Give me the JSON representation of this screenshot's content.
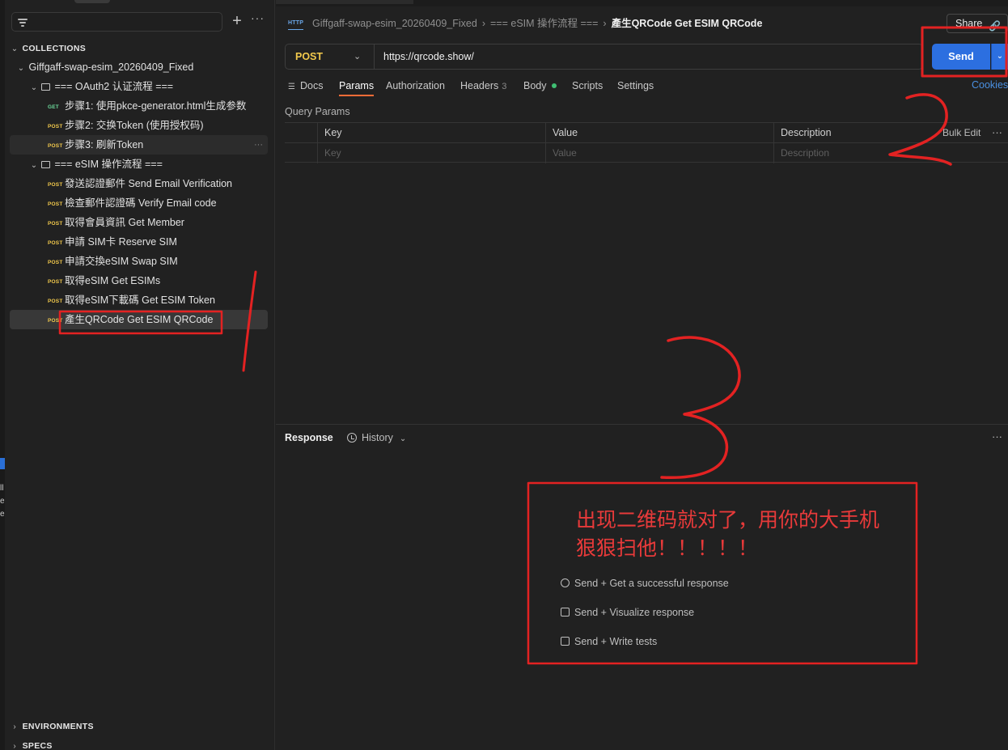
{
  "sidebar": {
    "filter_placeholder": "",
    "collections_label": "COLLECTIONS",
    "environments_label": "ENVIRONMENTS",
    "specs_label": "SPECS",
    "collection_name": "Giffgaff-swap-esim_20260409_Fixed",
    "folders": [
      {
        "name": "=== OAuth2 认证流程 ===",
        "requests": [
          {
            "method": "GET",
            "name": "步骤1: 使用pkce-generator.html生成参数"
          },
          {
            "method": "POST",
            "name": "步骤2: 交换Token (使用授权码)"
          },
          {
            "method": "POST",
            "name": "步骤3: 刷新Token"
          }
        ]
      },
      {
        "name": "=== eSIM 操作流程 ===",
        "requests": [
          {
            "method": "POST",
            "name": "發送認證郵件 Send Email Verification"
          },
          {
            "method": "POST",
            "name": "檢查郵件認證碼 Verify Email code"
          },
          {
            "method": "POST",
            "name": "取得會員資訊 Get Member"
          },
          {
            "method": "POST",
            "name": "申請 SIM卡 Reserve SIM"
          },
          {
            "method": "POST",
            "name": "申請交換eSIM Swap SIM"
          },
          {
            "method": "POST",
            "name": "取得eSIM Get ESIMs"
          },
          {
            "method": "POST",
            "name": "取得eSIM下載碼 Get ESIM Token"
          },
          {
            "method": "POST",
            "name": "產生QRCode Get ESIM QRCode"
          }
        ]
      }
    ]
  },
  "header": {
    "http_icon": "HTTP",
    "breadcrumb": [
      "Giffgaff-swap-esim_20260409_Fixed",
      "=== eSIM 操作流程 ===",
      "產生QRCode Get ESIM QRCode"
    ],
    "share_label": "Share"
  },
  "request": {
    "method": "POST",
    "url": "https://qrcode.show/",
    "send_label": "Send",
    "tabs": [
      {
        "label": "Docs"
      },
      {
        "label": "Params"
      },
      {
        "label": "Authorization"
      },
      {
        "label": "Headers",
        "count": "3"
      },
      {
        "label": "Body"
      },
      {
        "label": "Scripts"
      },
      {
        "label": "Settings"
      }
    ],
    "cookies_label": "Cookies"
  },
  "query_params": {
    "label": "Query Params",
    "columns": [
      "Key",
      "Value",
      "Description"
    ],
    "placeholders": [
      "Key",
      "Value",
      "Description"
    ],
    "bulk_edit_label": "Bulk Edit"
  },
  "response": {
    "title": "Response",
    "history_label": "History",
    "suggestions": [
      "Send + Get a successful response",
      "Send + Visualize response",
      "Send + Write tests"
    ]
  },
  "annotation": {
    "line1": "出现二维码就对了，用你的大手机",
    "line2": "狠狠扫他！！！！！",
    "color": "#e83a3a"
  },
  "colors": {
    "accent_send": "#2c6fe0",
    "method_post": "#f2c94c",
    "method_get": "#6bd99a",
    "tab_underline": "#ff6c37",
    "link": "#4a90e2"
  }
}
